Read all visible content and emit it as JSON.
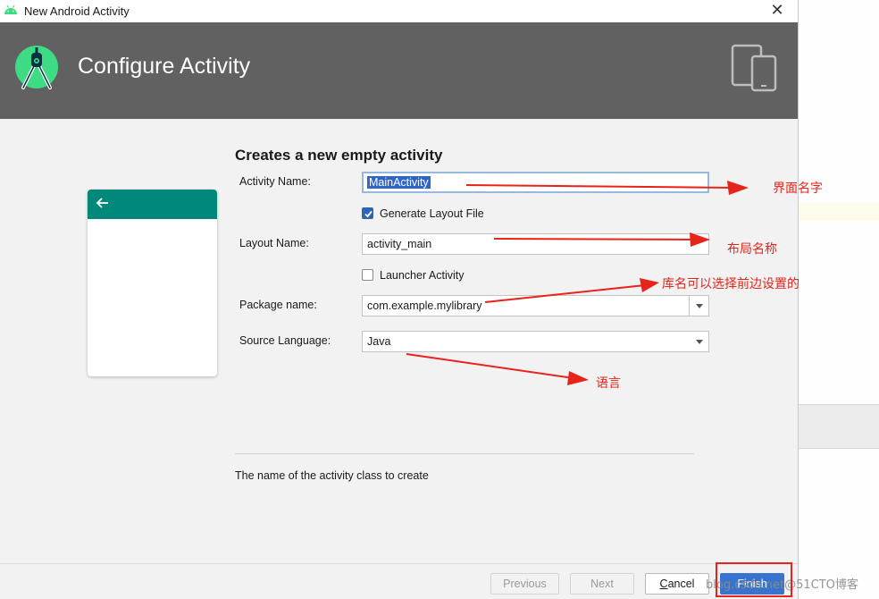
{
  "window": {
    "title": "New Android Activity",
    "close_glyph": "✕"
  },
  "header": {
    "title": "Configure Activity"
  },
  "form": {
    "heading": "Creates a new empty activity",
    "activity_name_label": "Activity Name:",
    "activity_name_value": "MainActivity",
    "generate_layout_label": "Generate Layout File",
    "generate_layout_checked": true,
    "layout_name_label": "Layout Name:",
    "layout_name_value": "activity_main",
    "launcher_activity_label": "Launcher Activity",
    "launcher_activity_checked": false,
    "package_name_label": "Package name:",
    "package_name_value": "com.example.mylibrary",
    "source_language_label": "Source Language:",
    "source_language_value": "Java",
    "description": "The name of the activity class to create"
  },
  "footer": {
    "previous_label": "Previous",
    "next_label": "Next",
    "cancel_label": "ancel",
    "cancel_mnemonic": "C",
    "finish_label": "Finish"
  },
  "annotations": {
    "activity_name_note": "界面名字",
    "layout_name_note": "布局名称",
    "package_name_note": "库名可以选择前边设置的",
    "language_note": "语言"
  },
  "watermark": "blog.csdn.net@51CTO博客",
  "colors": {
    "header_bg": "#616161",
    "accent_teal": "#00897b",
    "android_green": "#3ddc84",
    "annotation_red": "#e8231a",
    "primary_button": "#3874cf"
  },
  "icons": {
    "app": "android-head-icon",
    "logo": "android-studio-logo-icon",
    "devices": "tablet-phone-icon",
    "back": "back-arrow-icon"
  }
}
